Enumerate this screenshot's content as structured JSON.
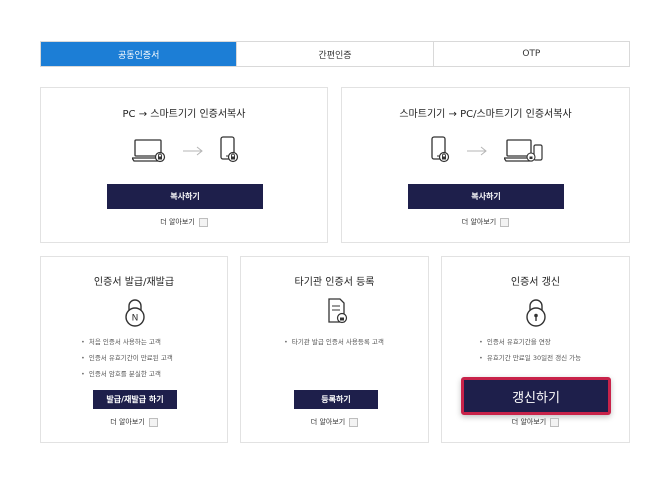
{
  "tabs": [
    {
      "label": "공동인증서",
      "active": true
    },
    {
      "label": "간편인증",
      "active": false
    },
    {
      "label": "OTP",
      "active": false
    }
  ],
  "cards": {
    "pc_to_phone": {
      "title": "PC → 스마트기기 인증서복사",
      "button": "복사하기",
      "more": "더 알아보기"
    },
    "phone_to_pc": {
      "title": "스마트기기 → PC/스마트기기 인증서복사",
      "button": "복사하기",
      "more": "더 알아보기"
    },
    "issue": {
      "title": "인증서 발급/재발급",
      "bullets": [
        "처음 인증서 사용하는 고객",
        "인증서 유효기간이 만료된 고객",
        "인증서 암호를 분실한 고객"
      ],
      "button": "발급/재발급 하기",
      "more": "더 알아보기"
    },
    "register": {
      "title": "타기관 인증서 등록",
      "bullets": [
        "타기관 발급 인증서 사용등록 고객"
      ],
      "button": "등록하기",
      "more": "더 알아보기"
    },
    "renew": {
      "title": "인증서 갱신",
      "bullets": [
        "인증서 유효기간을 연장",
        "유효기간 만료일 30일전 갱신 가능"
      ],
      "button": "갱신하기",
      "more": "더 알아보기"
    }
  },
  "colors": {
    "tab_active": "#1c7ed6",
    "button": "#1e1f4b",
    "highlight_border": "#c8234a"
  },
  "icons": {
    "laptop": "laptop-icon",
    "phone": "phone-icon",
    "arrow": "arrow-right-icon",
    "lock": "lock-icon",
    "document": "document-lock-icon"
  }
}
